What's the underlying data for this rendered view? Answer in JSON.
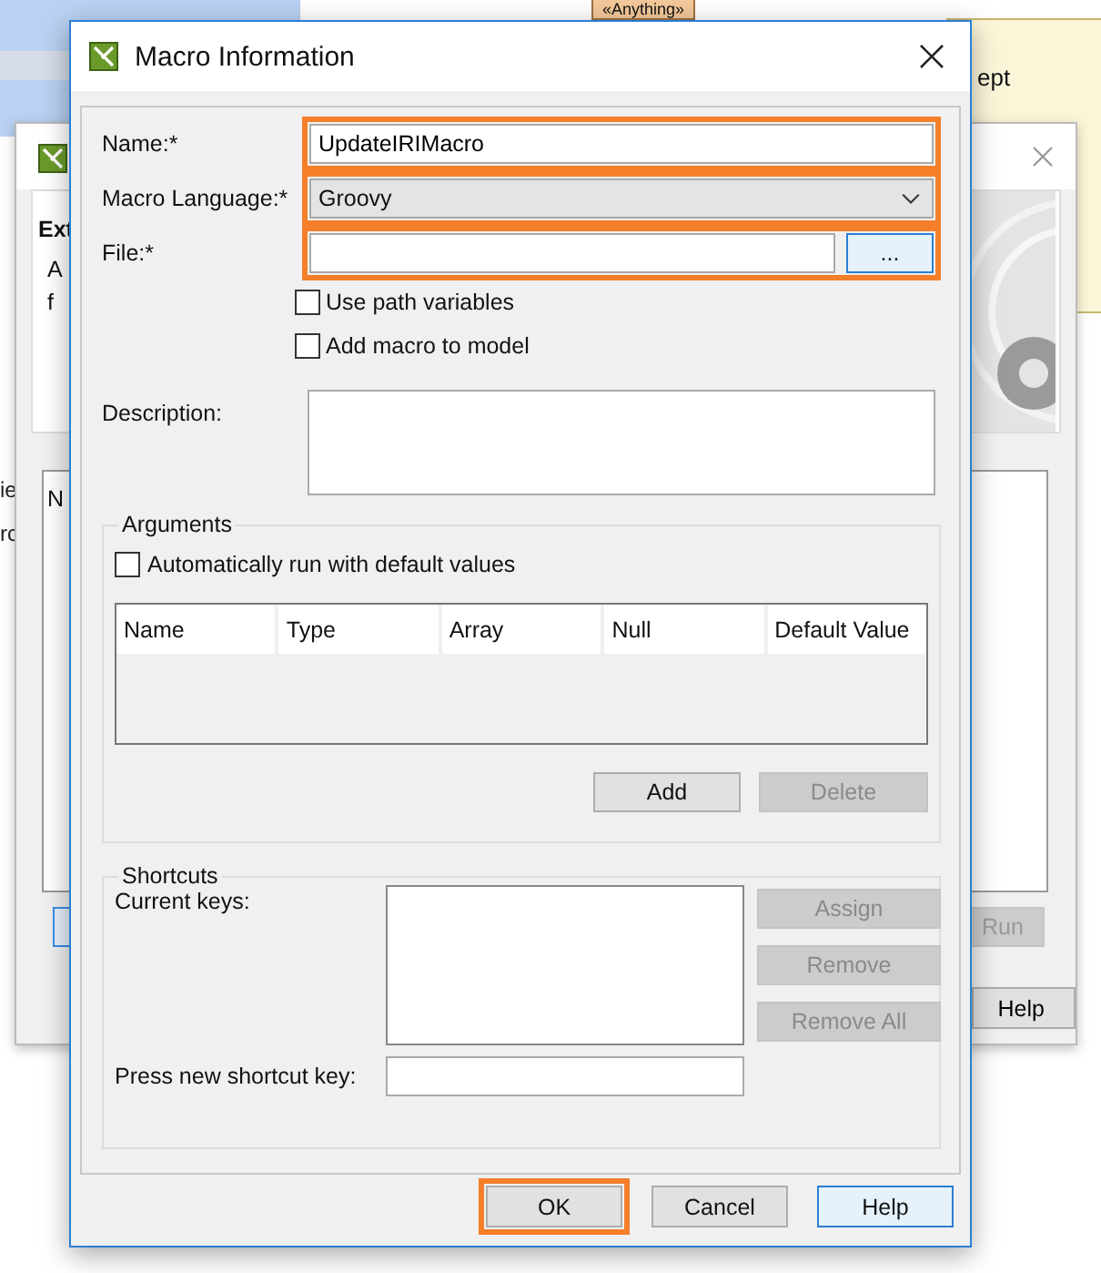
{
  "background": {
    "tag": "«Anything»",
    "note_text": "ept",
    "side_texts": [
      "ie",
      "rc"
    ],
    "back_window": {
      "heading": "Ext",
      "lines": [
        "A",
        "f"
      ],
      "column": "N",
      "run": {
        "label": "Run",
        "disabled": true
      },
      "help": "Help"
    }
  },
  "dialog": {
    "title": "Macro Information",
    "name": {
      "label": "Name:*",
      "value": "UpdateIRIMacro",
      "highlighted": true
    },
    "language": {
      "label": "Macro Language:*",
      "value": "Groovy",
      "highlighted": true
    },
    "file": {
      "label": "File:*",
      "browse": "...",
      "highlighted": true
    },
    "options": [
      {
        "label": "Use path variables",
        "checked": false
      },
      {
        "label": "Add macro to model",
        "checked": false
      }
    ],
    "description": {
      "label": "Description:"
    },
    "arguments": {
      "title": "Arguments",
      "auto_run": {
        "label": "Automatically run with default values",
        "checked": false
      },
      "columns": [
        "Name",
        "Type",
        "Array",
        "Null",
        "Default Value"
      ],
      "buttons": [
        {
          "label": "Add",
          "disabled": false
        },
        {
          "label": "Delete",
          "disabled": true
        }
      ]
    },
    "shortcuts": {
      "title": "Shortcuts",
      "current_label": "Current keys:",
      "press_label": "Press new shortcut key:",
      "buttons": [
        {
          "label": "Assign",
          "disabled": true
        },
        {
          "label": "Remove",
          "disabled": true
        },
        {
          "label": "Remove All",
          "disabled": true
        }
      ]
    },
    "buttons": [
      {
        "label": "OK",
        "highlighted": true,
        "focused": false
      },
      {
        "label": "Cancel",
        "highlighted": false,
        "focused": false
      },
      {
        "label": "Help",
        "highlighted": false,
        "focused": true
      }
    ]
  }
}
